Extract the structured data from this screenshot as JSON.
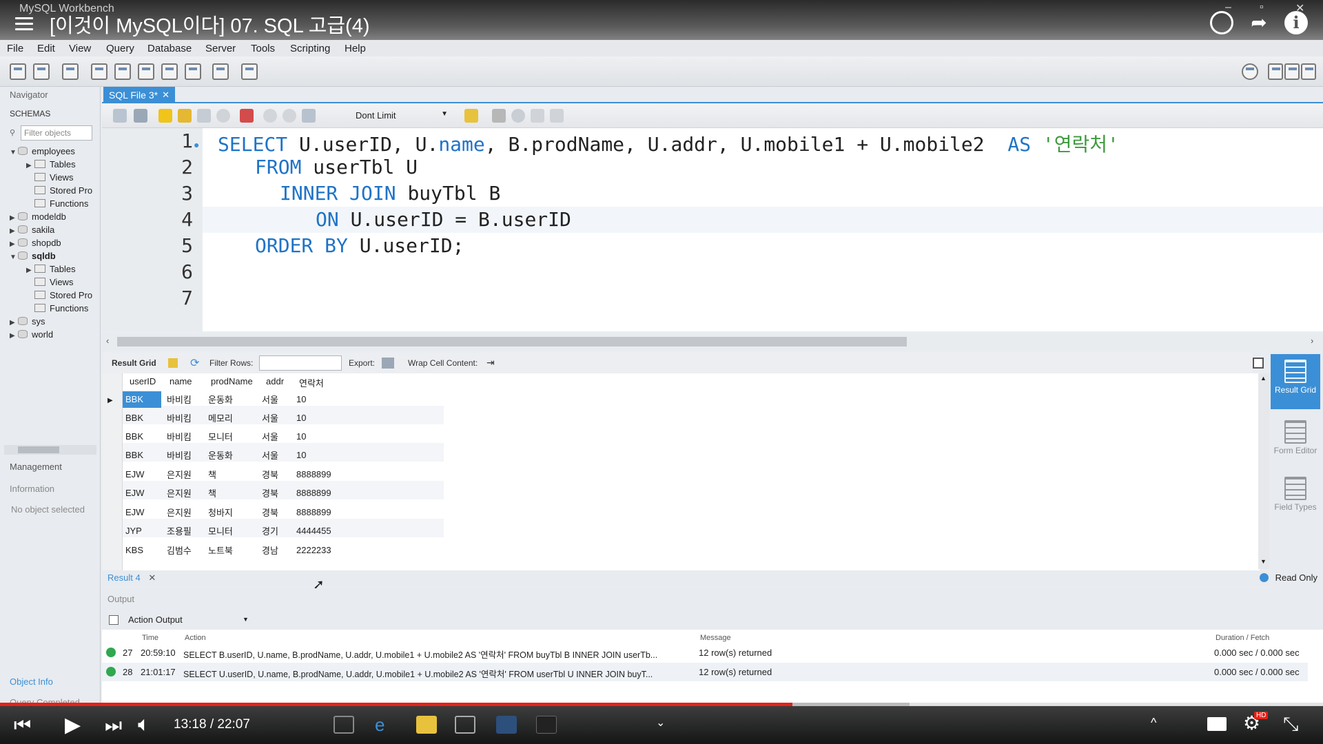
{
  "window": {
    "app_name": "MySQL Workbench",
    "video_title": "[이것이 MySQL이다] 07. SQL 고급(4)"
  },
  "menu": [
    "File",
    "Edit",
    "View",
    "Query",
    "Database",
    "Server",
    "Tools",
    "Scripting",
    "Help"
  ],
  "navigator": {
    "header": "Navigator",
    "schemas_label": "SCHEMAS",
    "filter_placeholder": "Filter objects",
    "tree": [
      {
        "label": "employees",
        "level": 0,
        "expanded": true
      },
      {
        "label": "Tables",
        "level": 1
      },
      {
        "label": "Views",
        "level": 1
      },
      {
        "label": "Stored Pro",
        "level": 1
      },
      {
        "label": "Functions",
        "level": 1
      },
      {
        "label": "modeldb",
        "level": 0
      },
      {
        "label": "sakila",
        "level": 0
      },
      {
        "label": "shopdb",
        "level": 0
      },
      {
        "label": "sqldb",
        "level": 0,
        "expanded": true,
        "bold": true
      },
      {
        "label": "Tables",
        "level": 1
      },
      {
        "label": "Views",
        "level": 1
      },
      {
        "label": "Stored Pro",
        "level": 1
      },
      {
        "label": "Functions",
        "level": 1
      },
      {
        "label": "sys",
        "level": 0
      },
      {
        "label": "world",
        "level": 0
      }
    ],
    "management_label": "Management",
    "information_label": "Information",
    "no_object_text": "No object selected",
    "object_info_label": "Object Info",
    "status_text": "Query Completed"
  },
  "editor": {
    "tab_label": "SQL File 3*",
    "limit_label": "Dont Limit",
    "lines": [
      "1",
      "2",
      "3",
      "4",
      "5",
      "6",
      "7"
    ]
  },
  "result_toolbar": {
    "result_grid": "Result Grid",
    "filter_rows": "Filter Rows:",
    "export": "Export:",
    "wrap": "Wrap Cell Content:"
  },
  "grid": {
    "columns": [
      "userID",
      "name",
      "prodName",
      "addr",
      "연락처"
    ],
    "rows": [
      [
        "BBK",
        "바비킴",
        "운동화",
        "서울",
        "10"
      ],
      [
        "BBK",
        "바비킴",
        "메모리",
        "서울",
        "10"
      ],
      [
        "BBK",
        "바비킴",
        "모니터",
        "서울",
        "10"
      ],
      [
        "BBK",
        "바비킴",
        "운동화",
        "서울",
        "10"
      ],
      [
        "EJW",
        "은지원",
        "책",
        "경북",
        "8888899"
      ],
      [
        "EJW",
        "은지원",
        "책",
        "경북",
        "8888899"
      ],
      [
        "EJW",
        "은지원",
        "청바지",
        "경북",
        "8888899"
      ],
      [
        "JYP",
        "조용필",
        "모니터",
        "경기",
        "4444455"
      ],
      [
        "KBS",
        "김범수",
        "노트북",
        "경남",
        "2222233"
      ]
    ]
  },
  "right_panel": [
    "Result Grid",
    "Form Editor",
    "Field Types"
  ],
  "result_tab": "Result 4",
  "read_only": "Read Only",
  "output": {
    "header": "Output",
    "selector": "Action Output",
    "columns": [
      "Time",
      "Action",
      "Message",
      "Duration / Fetch"
    ],
    "rows": [
      {
        "num": "27",
        "time": "20:59:10",
        "action": "SELECT B.userID, U.name, B.prodName, U.addr, U.mobile1 + U.mobile2  AS '연락처'    FROM buyTbl B     INNER JOIN userTb...",
        "message": "12 row(s) returned",
        "duration": "0.000 sec / 0.000 sec"
      },
      {
        "num": "28",
        "time": "21:01:17",
        "action": "SELECT U.userID, U.name, B.prodName, U.addr, U.mobile1 + U.mobile2  AS '연락처'    FROM userTbl U     INNER JOIN buyT...",
        "message": "12 row(s) returned",
        "duration": "0.000 sec / 0.000 sec"
      }
    ]
  },
  "video": {
    "time": "13:18 / 22:07",
    "progress": 0.6
  },
  "colors": {
    "accent": "#3b8fd6",
    "keyword": "#1f73c7",
    "string": "#3d9a3d",
    "progress": "#e62117"
  }
}
